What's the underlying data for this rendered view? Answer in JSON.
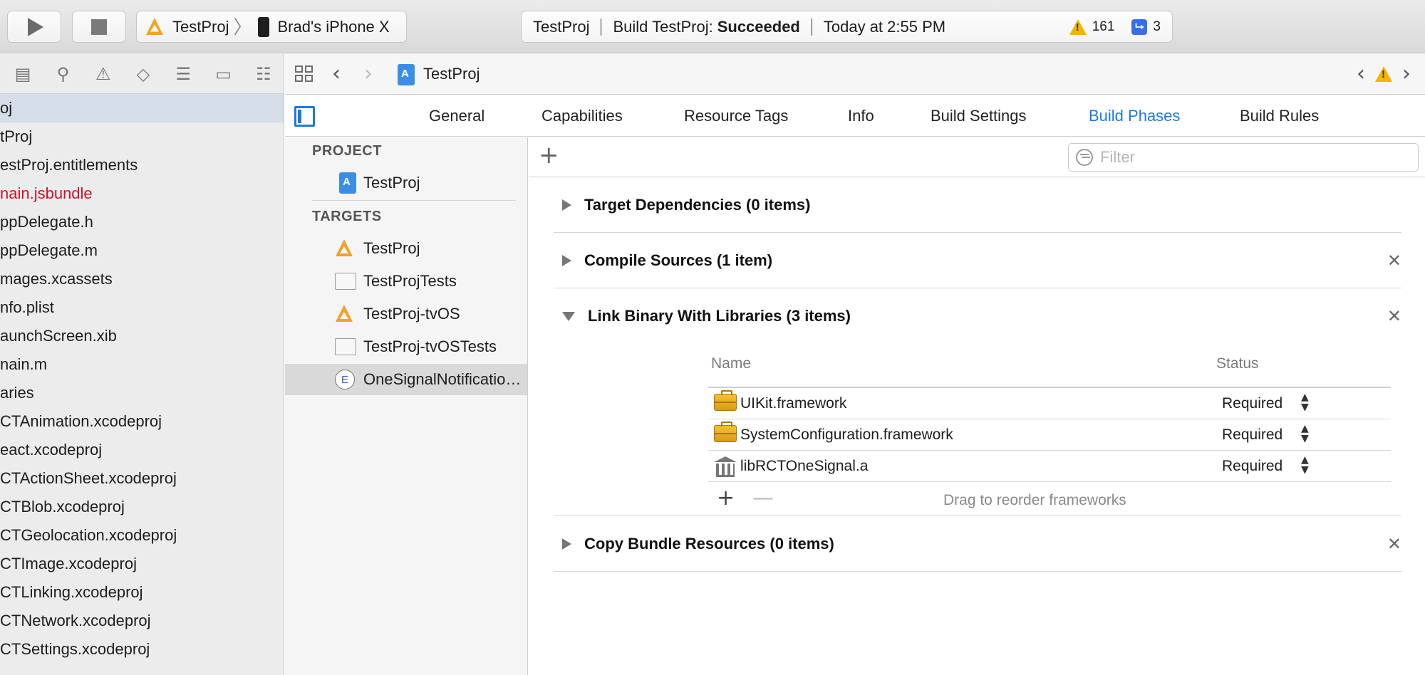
{
  "toolbar": {
    "run_icon": "play-icon",
    "stop_icon": "stop-icon",
    "scheme": {
      "project": "TestProj",
      "separator": "〉",
      "device": "Brad's iPhone X"
    },
    "activity": {
      "project": "TestProj",
      "status_prefix": "Build TestProj:",
      "status_result": "Succeeded",
      "time": "Today at 2:55 PM",
      "warnings_count": "161",
      "issues_count": "3"
    }
  },
  "navigator": {
    "items": [
      {
        "label": "oj",
        "selected": true
      },
      {
        "label": "tProj"
      },
      {
        "label": "estProj.entitlements"
      },
      {
        "label": "nain.jsbundle",
        "color": "#d1102a"
      },
      {
        "label": "ppDelegate.h"
      },
      {
        "label": "ppDelegate.m"
      },
      {
        "label": "mages.xcassets"
      },
      {
        "label": "nfo.plist"
      },
      {
        "label": "aunchScreen.xib"
      },
      {
        "label": "nain.m"
      },
      {
        "label": "aries"
      },
      {
        "label": "CTAnimation.xcodeproj"
      },
      {
        "label": "eact.xcodeproj"
      },
      {
        "label": "CTActionSheet.xcodeproj"
      },
      {
        "label": "CTBlob.xcodeproj"
      },
      {
        "label": "CTGeolocation.xcodeproj"
      },
      {
        "label": "CTImage.xcodeproj"
      },
      {
        "label": "CTLinking.xcodeproj"
      },
      {
        "label": "CTNetwork.xcodeproj"
      },
      {
        "label": "CTSettings.xcodeproj"
      }
    ]
  },
  "editor": {
    "breadcrumb_title": "TestProj",
    "tabs": [
      {
        "label": "General"
      },
      {
        "label": "Capabilities"
      },
      {
        "label": "Resource Tags"
      },
      {
        "label": "Info"
      },
      {
        "label": "Build Settings"
      },
      {
        "label": "Build Phases",
        "active": true
      },
      {
        "label": "Build Rules"
      }
    ],
    "active_tab_color": "#1a7ae6"
  },
  "targets_pane": {
    "project_header": "PROJECT",
    "project_item": "TestProj",
    "targets_header": "TARGETS",
    "targets": [
      {
        "label": "TestProj",
        "icon": "app-icon"
      },
      {
        "label": "TestProjTests",
        "icon": "test-bundle-icon"
      },
      {
        "label": "TestProj-tvOS",
        "icon": "app-icon"
      },
      {
        "label": "TestProj-tvOSTests",
        "icon": "test-bundle-icon"
      },
      {
        "label": "OneSignalNotificatio…",
        "icon": "extension-icon",
        "selected": true
      }
    ]
  },
  "phases": {
    "filter_placeholder": "Filter",
    "items": [
      {
        "title": "Target Dependencies (0 items)",
        "expanded": false,
        "closable": false
      },
      {
        "title": "Compile Sources (1 item)",
        "expanded": false,
        "closable": true
      },
      {
        "title": "Link Binary With Libraries (3 items)",
        "expanded": true,
        "closable": true
      },
      {
        "title": "Copy Bundle Resources (0 items)",
        "expanded": false,
        "closable": true
      }
    ],
    "libraries": {
      "col_name": "Name",
      "col_status": "Status",
      "rows": [
        {
          "name": "UIKit.framework",
          "status": "Required",
          "icon": "framework-icon"
        },
        {
          "name": "SystemConfiguration.framework",
          "status": "Required",
          "icon": "framework-icon"
        },
        {
          "name": "libRCTOneSignal.a",
          "status": "Required",
          "icon": "library-icon"
        }
      ],
      "hint": "Drag to reorder frameworks"
    }
  }
}
